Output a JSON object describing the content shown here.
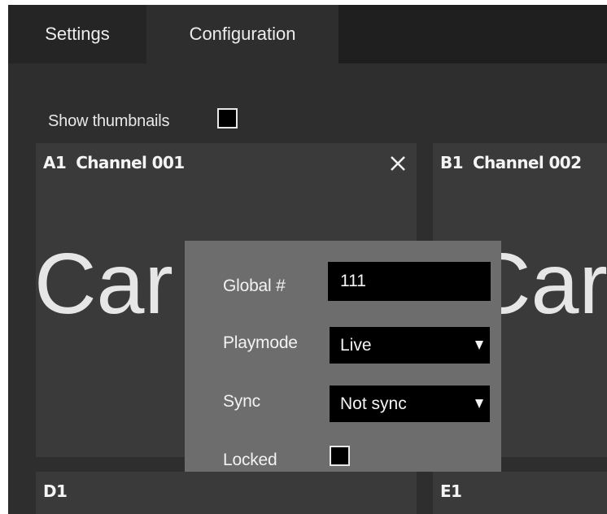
{
  "tabs": [
    {
      "label": "Settings"
    },
    {
      "label": "Configuration"
    }
  ],
  "show_thumbnails": {
    "label": "Show thumbnails",
    "checked": false
  },
  "tiles": [
    {
      "slot": "A1",
      "channel": "Channel 001",
      "preview_text": "Car",
      "closable": true
    },
    {
      "slot": "B1",
      "channel": "Channel 002",
      "preview_text": "Car"
    },
    {
      "slot": "D1",
      "channel": ""
    },
    {
      "slot": "E1",
      "channel": ""
    }
  ],
  "popup": {
    "global_label": "Global #",
    "global_value": "111",
    "playmode_label": "Playmode",
    "playmode_value": "Live",
    "sync_label": "Sync",
    "sync_value": "Not sync",
    "locked_label": "Locked",
    "locked_checked": false
  },
  "icons": {
    "close": "close-icon",
    "dropdown": "chevron-down-icon"
  },
  "colors": {
    "app_background": "#2e2e2e",
    "tabbar_background": "#1f1f1f",
    "tile_background": "#3a3a3a",
    "popup_background": "#6d6d6d",
    "input_background": "#000000",
    "text": "#f2f2f2"
  }
}
